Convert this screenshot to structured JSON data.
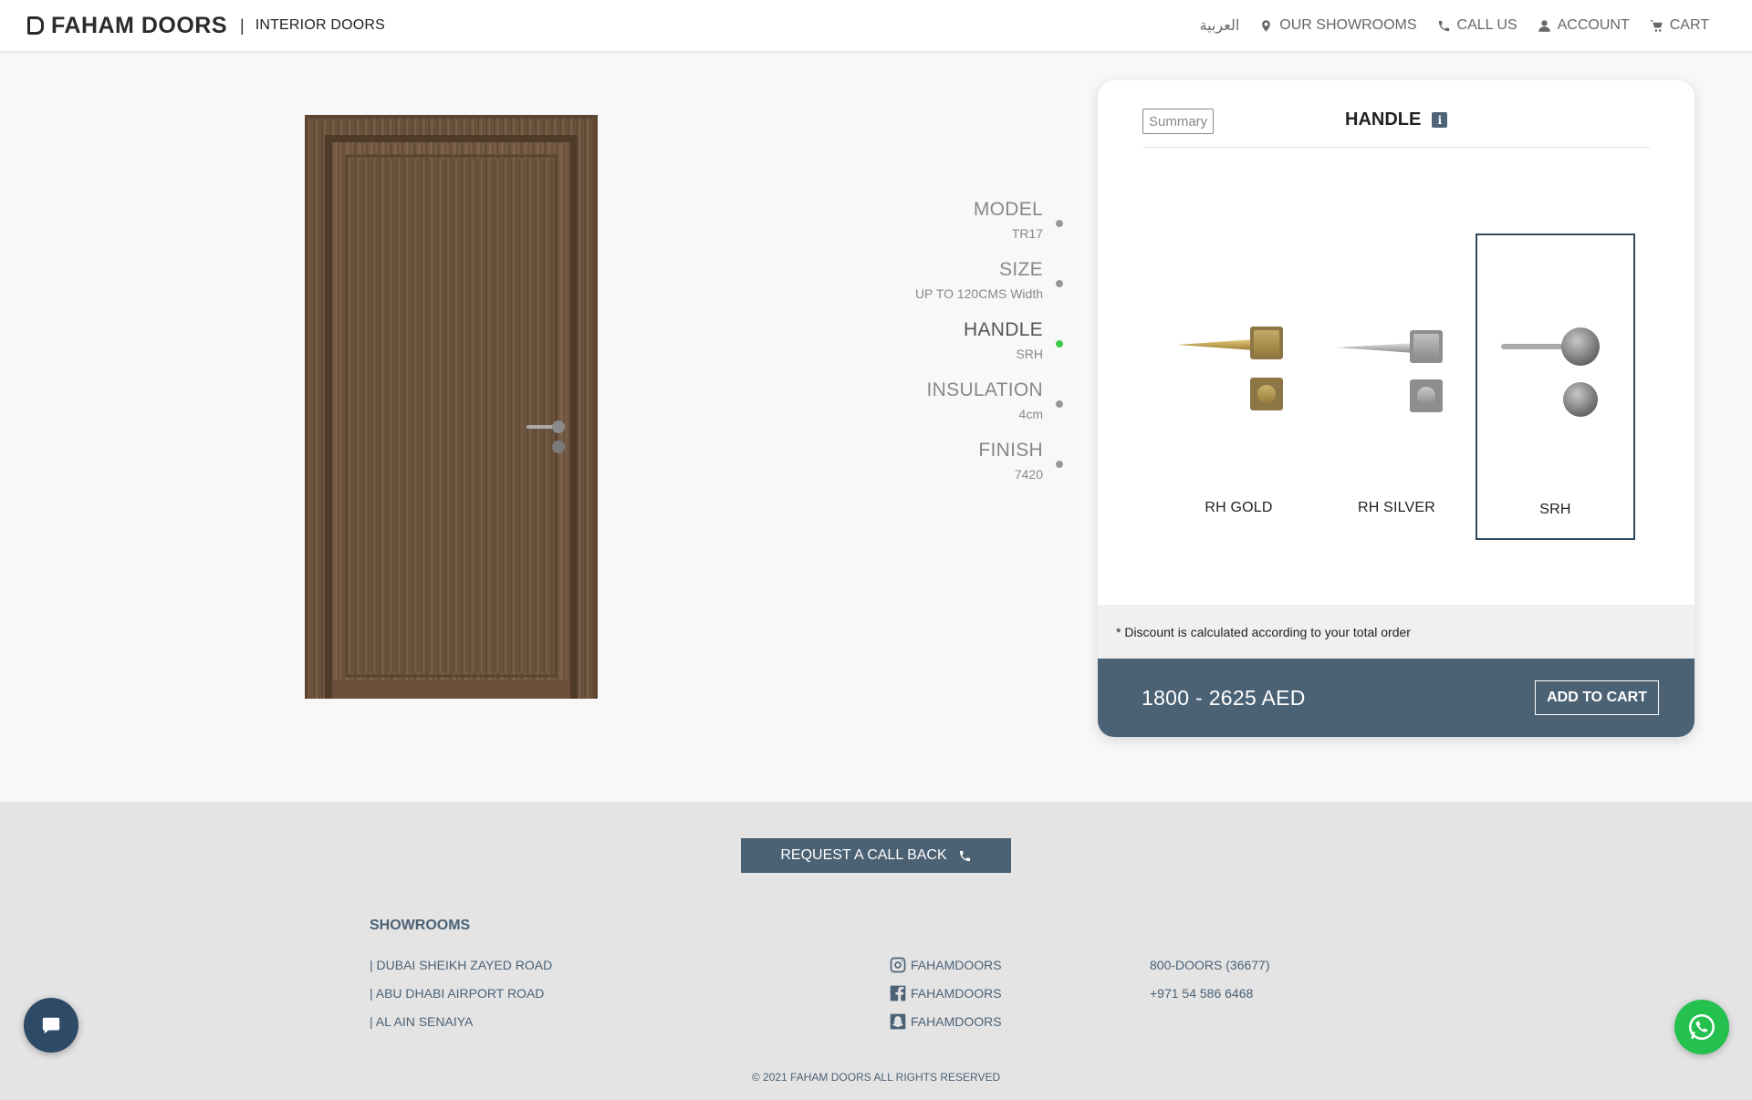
{
  "header": {
    "brand": "FAHAM DOORS",
    "category": "INTERIOR DOORS",
    "nav": {
      "language": "العربية",
      "showrooms": "OUR SHOWROOMS",
      "call": "CALL US",
      "account": "ACCOUNT",
      "cart": "CART"
    }
  },
  "steps": [
    {
      "name": "MODEL",
      "value": "TR17"
    },
    {
      "name": "SIZE",
      "value": "UP TO 120CMS Width"
    },
    {
      "name": "HANDLE",
      "value": "SRH"
    },
    {
      "name": "INSULATION",
      "value": "4cm"
    },
    {
      "name": "FINISH",
      "value": "7420"
    }
  ],
  "card": {
    "summary_label": "Summary",
    "title": "HANDLE",
    "info_icon": "i",
    "options": [
      {
        "label": "RH GOLD",
        "selected": false
      },
      {
        "label": "RH SILVER",
        "selected": false
      },
      {
        "label": "SRH",
        "selected": true
      }
    ],
    "discount_note": "* Discount is calculated according to your total order",
    "price": "1800 - 2625 AED",
    "add_to_cart": "ADD TO CART"
  },
  "footer": {
    "callback": "REQUEST A CALL BACK",
    "showrooms_title": "SHOWROOMS",
    "showrooms": [
      "| DUBAI SHEIKH ZAYED ROAD",
      "| ABU DHABI AIRPORT ROAD",
      "| AL AIN SENAIYA"
    ],
    "social": [
      "FAHAMDOORS",
      "FAHAMDOORS",
      "FAHAMDOORS"
    ],
    "phones": [
      "800-DOORS (36677)",
      "+971 54 586 6468"
    ],
    "copyright": "© 2021 FAHAM DOORS ALL RIGHTS RESERVED"
  },
  "colors": {
    "accent": "#4b6275",
    "active_step": "#3ec94b",
    "whatsapp": "#25c14f"
  }
}
